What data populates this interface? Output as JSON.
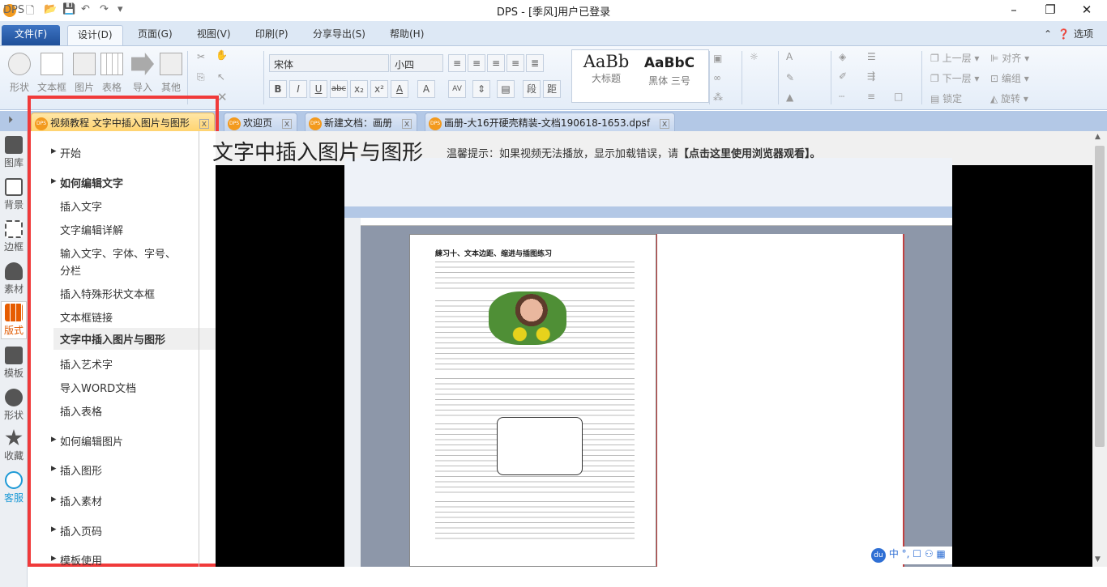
{
  "window": {
    "title": "DPS - [季风]用户已登录",
    "logo": "DPS"
  },
  "quick_access": [
    "new-icon",
    "open-icon",
    "save-icon",
    "undo-icon",
    "redo-icon",
    "customize-icon"
  ],
  "menu": {
    "items": [
      "文件(F)",
      "设计(D)",
      "页面(G)",
      "视图(V)",
      "印刷(P)",
      "分享导出(S)",
      "帮助(H)"
    ],
    "active": "设计(D)",
    "options": "选项"
  },
  "ribbon": {
    "insert": [
      "形状",
      "文本框",
      "图片",
      "表格",
      "导入",
      "其他"
    ],
    "font": "宋体",
    "size": "小四",
    "format_buttons": [
      "B",
      "I",
      "U",
      "abc",
      "x₂",
      "x²",
      "A",
      "A"
    ],
    "para_buttons": [
      "段",
      "距"
    ],
    "styles": [
      {
        "sample": "AaBb",
        "label": "大标题"
      },
      {
        "sample": "AaBbC",
        "label": "黑体 三号"
      }
    ],
    "arrange": [
      "上一层",
      "对齐",
      "下一层",
      "编组",
      "锁定",
      "旋转"
    ]
  },
  "tabs": [
    {
      "label": "视频教程 文字中插入图片与图形",
      "active": true
    },
    {
      "label": "欢迎页"
    },
    {
      "label": "新建文档：画册"
    },
    {
      "label": "画册-大16开硬壳精装-文档190618-1653.dpsf"
    }
  ],
  "leftbar": [
    {
      "label": "图库"
    },
    {
      "label": "背景"
    },
    {
      "label": "边框"
    },
    {
      "label": "素材"
    },
    {
      "label": "版式",
      "active": true
    },
    {
      "label": "模板"
    },
    {
      "label": "形状"
    },
    {
      "label": "收藏"
    },
    {
      "label": "客服"
    }
  ],
  "tutorial": {
    "items": [
      {
        "label": "开始",
        "type": "section"
      },
      {
        "label": "如何编辑文字",
        "type": "section",
        "bold": true
      },
      {
        "label": "插入文字"
      },
      {
        "label": "文字编辑详解"
      },
      {
        "label": "输入文字、字体、字号、"
      },
      {
        "label": "分栏"
      },
      {
        "label": "插入特殊形状文本框"
      },
      {
        "label": "文本框链接"
      },
      {
        "label": "文字中插入图片与图形",
        "selected": true
      },
      {
        "label": "插入艺术字"
      },
      {
        "label": "导入WORD文档"
      },
      {
        "label": "插入表格"
      },
      {
        "label": "如何编辑图片",
        "type": "section"
      },
      {
        "label": "插入图形",
        "type": "section"
      },
      {
        "label": "插入素材",
        "type": "section"
      },
      {
        "label": "插入页码",
        "type": "section"
      },
      {
        "label": "模板使用",
        "type": "section"
      }
    ]
  },
  "video": {
    "title": "文字中插入图片与图形",
    "hint": "温馨提示：如果视频无法播放，显示加载错误，请",
    "hint_link": "【点击这里使用浏览器观看】。",
    "page_heading": "練习十、文本边距、缩进与插图练习",
    "ime": "中"
  }
}
